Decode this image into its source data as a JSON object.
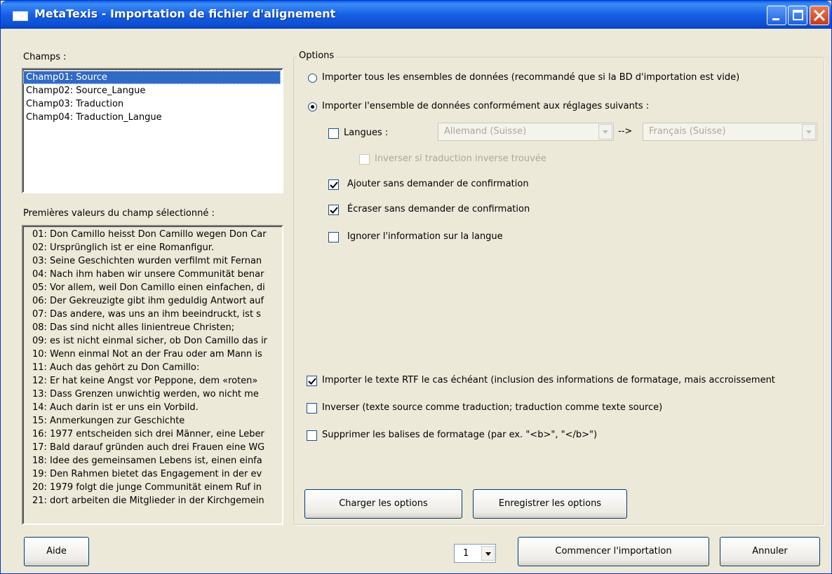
{
  "window": {
    "title": "MetaTexis - Importation de fichier d'alignement",
    "accent_color": "#0a5fe0"
  },
  "fields": {
    "label": "Champs :",
    "items": [
      {
        "label": "Champ01: Source",
        "selected": true
      },
      {
        "label": "Champ02: Source_Langue",
        "selected": false
      },
      {
        "label": "Champ03: Traduction",
        "selected": false
      },
      {
        "label": "Champ04: Traduction_Langue",
        "selected": false
      }
    ]
  },
  "values": {
    "label": "Premières valeurs du champ sélectionné :",
    "items": [
      "01: Don Camillo heisst Don Camillo wegen Don Car",
      "02: Ursprünglich ist er eine Romanfigur.",
      "03: Seine Geschichten wurden verfilmt mit Fernan",
      "04: Nach ihm haben wir unsere Communität benar",
      "05: Vor allem, weil Don Camillo einen einfachen, di",
      "06: Der Gekreuzigte gibt ihm geduldig Antwort auf",
      "07: Das andere, was uns an ihm beeindruckt, ist s",
      "08: Das sind nicht alles linientreue Christen;",
      "09: es ist nicht einmal sicher, ob Don Camillo das ir",
      "10: Wenn einmal Not an der Frau oder am Mann is",
      "11: Auch das gehört zu Don Camillo:",
      "12: Er hat keine Angst vor Peppone, dem «roten»",
      "13: Dass  Grenzen unwichtig werden, wo nicht me",
      "14: Auch darin ist er uns ein Vorbild.",
      "15: Anmerkungen zur Geschichte",
      "16: 1977 entscheiden sich drei Männer, eine Leber",
      "17: Bald darauf gründen auch drei Frauen eine WG",
      "18: Idee des gemeinsamen Lebens ist, einen einfa",
      "19: Den Rahmen bietet das Engagement in der ev",
      "20: 1979 folgt die junge Communität einem Ruf in",
      "21: dort arbeiten die Mitglieder in der Kirchgemein"
    ]
  },
  "options": {
    "legend": "Options",
    "radio_all": {
      "label": "Importer tous les ensembles de données (recommandé que si la BD d'importation est vide)",
      "selected": false
    },
    "radio_settings": {
      "label": "Importer l'ensemble de données conformément aux réglages suivants :",
      "selected": true
    },
    "languages": {
      "label": "Langues :",
      "checked": false,
      "source": "Allemand (Suisse)",
      "arrow": "-->",
      "target": "Français (Suisse)",
      "invert": {
        "label": "Inverser si traduction inverse trouvée",
        "checked": false
      }
    },
    "add_no_confirm": {
      "label": "Ajouter sans demander de confirmation",
      "checked": true
    },
    "overwrite_no_confirm": {
      "label": "Écraser sans demander de confirmation",
      "checked": true
    },
    "ignore_language": {
      "label": "Ignorer l'information sur la langue",
      "checked": false
    },
    "import_rtf": {
      "label": "Importer le texte RTF le cas échéant (inclusion des informations de formatage, mais accroissement",
      "checked": true
    },
    "invert_all": {
      "label": "Inverser (texte source comme traduction; traduction comme texte source)",
      "checked": false
    },
    "strip_tags": {
      "label": "Supprimer les balises de formatage (par ex. \"<b>\", \"</b>\")",
      "checked": false
    },
    "load_button": "Charger les options",
    "save_button": "Enregistrer les options"
  },
  "footer": {
    "help_button": "Aide",
    "counter_value": "1",
    "start_button": "Commencer l'importation",
    "cancel_button": "Annuler"
  }
}
